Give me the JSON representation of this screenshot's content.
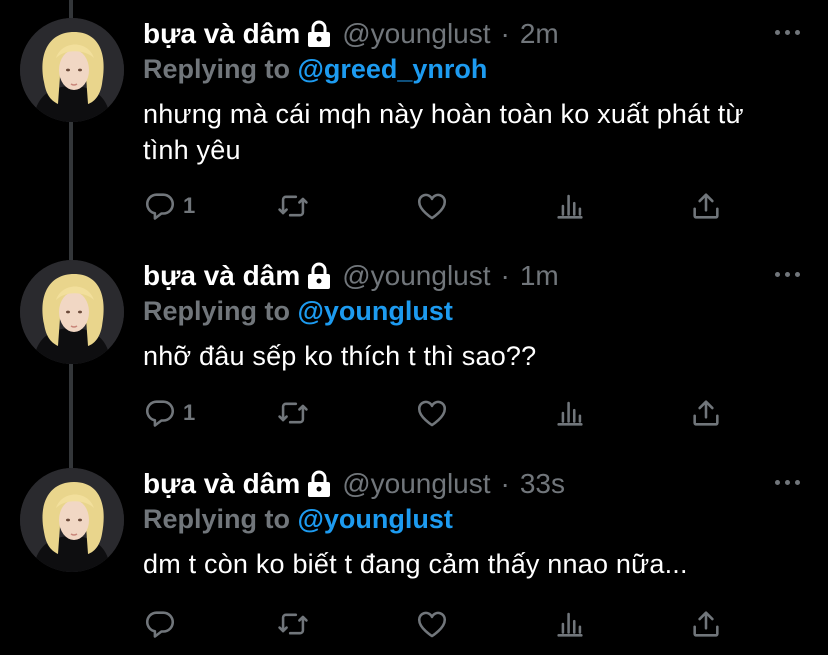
{
  "colors": {
    "background": "#000000",
    "text": "#ffffff",
    "muted": "#71767b",
    "accent": "#1d9bf0",
    "thread_line": "#333639"
  },
  "tweets": [
    {
      "display_name": "bựa và dâm",
      "handle": "@younglust",
      "separator": "·",
      "time": "2m",
      "reply_prefix": "Replying to",
      "reply_to": "@greed_ynroh",
      "text": "nhưng mà cái mqh này hoàn toàn ko xuất phát từ tình yêu",
      "reply_count": "1"
    },
    {
      "display_name": "bựa và dâm",
      "handle": "@younglust",
      "separator": "·",
      "time": "1m",
      "reply_prefix": "Replying to",
      "reply_to": "@younglust",
      "text": "nhỡ đâu sếp ko thích t thì sao??",
      "reply_count": "1"
    },
    {
      "display_name": "bựa và dâm",
      "handle": "@younglust",
      "separator": "·",
      "time": "33s",
      "reply_prefix": "Replying to",
      "reply_to": "@younglust",
      "text": "dm t còn ko biết t đang cảm thấy nnao nữa...",
      "reply_count": ""
    }
  ],
  "icons": {
    "lock": "lock-icon",
    "reply": "reply-icon",
    "retweet": "retweet-icon",
    "like": "heart-icon",
    "analytics": "analytics-icon",
    "share": "share-icon",
    "more": "more-icon"
  }
}
